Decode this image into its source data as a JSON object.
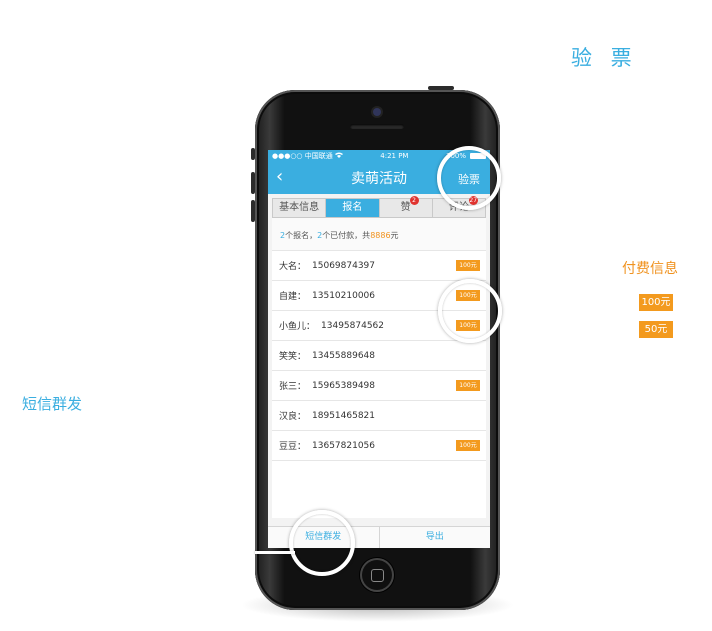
{
  "annotations": {
    "ticket": "验 票",
    "payment_info": "付费信息",
    "payment_badges": [
      "100元",
      "50元"
    ],
    "sms": "短信群发"
  },
  "statusbar": {
    "carrier": "●●●○○ 中国联通",
    "time": "4:21 PM",
    "battery": "100%"
  },
  "navbar": {
    "back": "‹",
    "title": "卖萌活动",
    "right_button": "验票"
  },
  "tabs": [
    {
      "label": "基本信息",
      "active": false
    },
    {
      "label": "报名",
      "active": true
    },
    {
      "label": "赞",
      "active": false,
      "badge": "2"
    },
    {
      "label": "评论",
      "active": false,
      "badge": "27"
    }
  ],
  "summary": {
    "signup_count": "2",
    "signup_text": "个报名，",
    "paid_count": "2",
    "paid_text": "个已付款，共",
    "amount": "8886",
    "amount_unit": "元"
  },
  "participants": [
    {
      "name": "大名：",
      "phone": "15069874397",
      "badge": "100元"
    },
    {
      "name": "自建：",
      "phone": "13510210006",
      "badge": "100元"
    },
    {
      "name": "小鱼儿：",
      "phone": "13495874562",
      "badge": "100元"
    },
    {
      "name": "笑笑：",
      "phone": "13455889648",
      "badge": ""
    },
    {
      "name": "张三：",
      "phone": "15965389498",
      "badge": "100元"
    },
    {
      "name": "汉良：",
      "phone": "18951465821",
      "badge": ""
    },
    {
      "name": "豆豆：",
      "phone": "13657821056",
      "badge": "100元"
    }
  ],
  "bottombar": {
    "sms_button": "短信群发",
    "export_button": "导出"
  },
  "colors": {
    "accent_blue": "#3aaee0",
    "badge_orange": "#f39a1e",
    "alert_red": "#e0332f"
  }
}
